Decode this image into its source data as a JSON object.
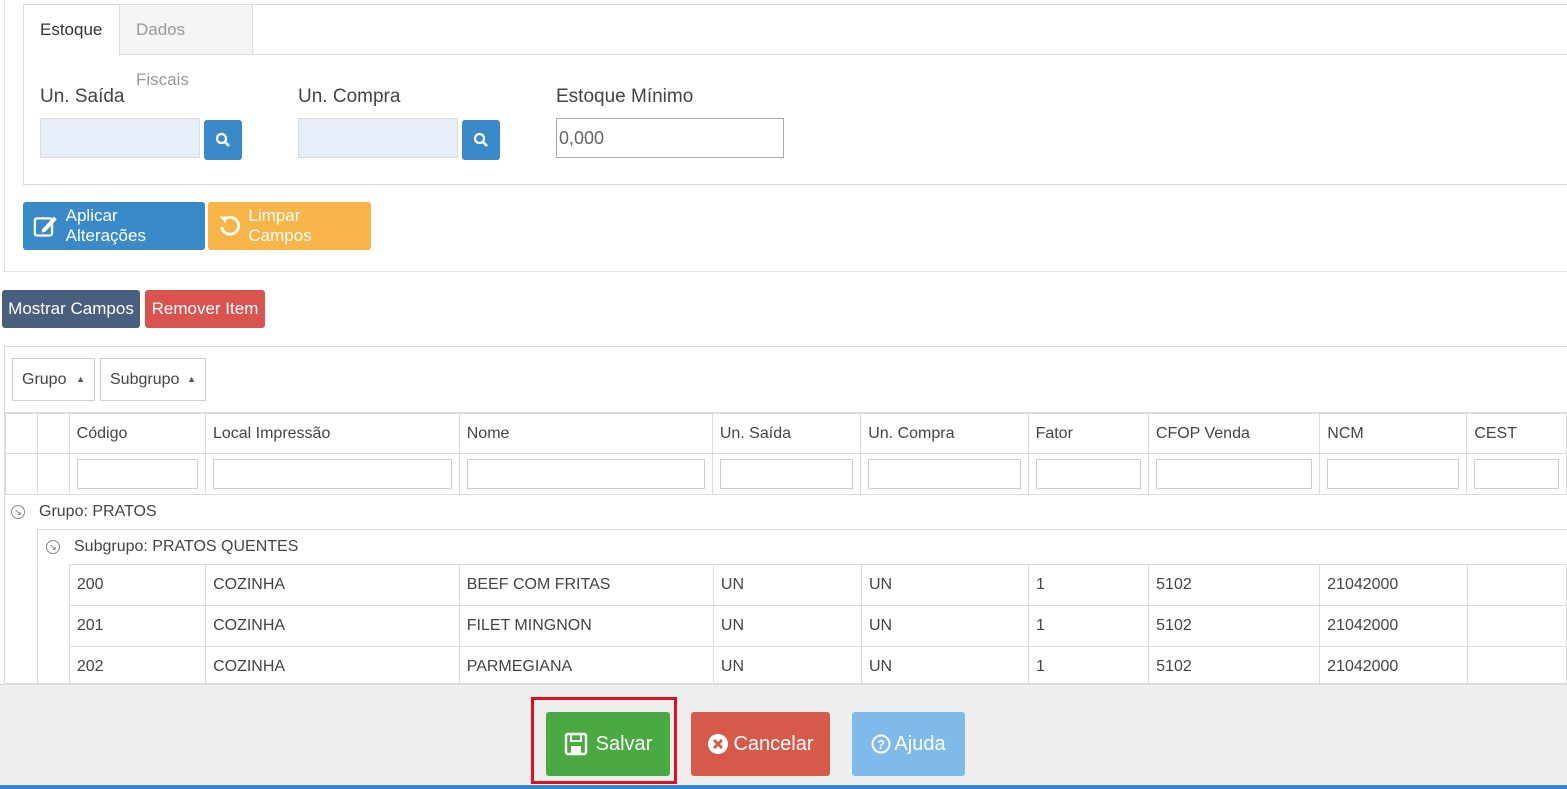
{
  "tabs": [
    {
      "label": "Estoque",
      "active": true
    },
    {
      "label": "Dados Fiscais",
      "active": false
    }
  ],
  "fields": {
    "un_saida": {
      "label": "Un. Saída",
      "value": ""
    },
    "un_compra": {
      "label": "Un. Compra",
      "value": ""
    },
    "estoque_minimo": {
      "label": "Estoque Mínimo",
      "value": "0,000"
    }
  },
  "actions": {
    "aplicar": "Aplicar Alterações",
    "limpar": "Limpar Campos",
    "mostrar": "Mostrar Campos",
    "remover": "Remover Item"
  },
  "grid": {
    "group_chips": [
      "Grupo",
      "Subgrupo"
    ],
    "columns": [
      "Código",
      "Local Impressão",
      "Nome",
      "Un. Saída",
      "Un. Compra",
      "Fator",
      "CFOP Venda",
      "NCM",
      "CEST"
    ],
    "group_label": "Grupo: PRATOS",
    "subgroup_label": "Subgrupo: PRATOS QUENTES",
    "rows": [
      {
        "codigo": "200",
        "local": "COZINHA",
        "nome": "BEEF COM FRITAS",
        "un_saida": "UN",
        "un_compra": "UN",
        "fator": "1",
        "cfop": "5102",
        "ncm": "21042000",
        "cest": ""
      },
      {
        "codigo": "201",
        "local": "COZINHA",
        "nome": "FILET MINGNON",
        "un_saida": "UN",
        "un_compra": "UN",
        "fator": "1",
        "cfop": "5102",
        "ncm": "21042000",
        "cest": ""
      },
      {
        "codigo": "202",
        "local": "COZINHA",
        "nome": "PARMEGIANA",
        "un_saida": "UN",
        "un_compra": "UN",
        "fator": "1",
        "cfop": "5102",
        "ncm": "21042000",
        "cest": ""
      }
    ]
  },
  "footer": {
    "salvar": "Salvar",
    "cancelar": "Cancelar",
    "ajuda": "Ajuda"
  },
  "colors": {
    "primary": "#3a89c9",
    "warning": "#f7b448",
    "danger": "#d9534f",
    "success": "#4aa943",
    "highlight": "#e01020"
  }
}
